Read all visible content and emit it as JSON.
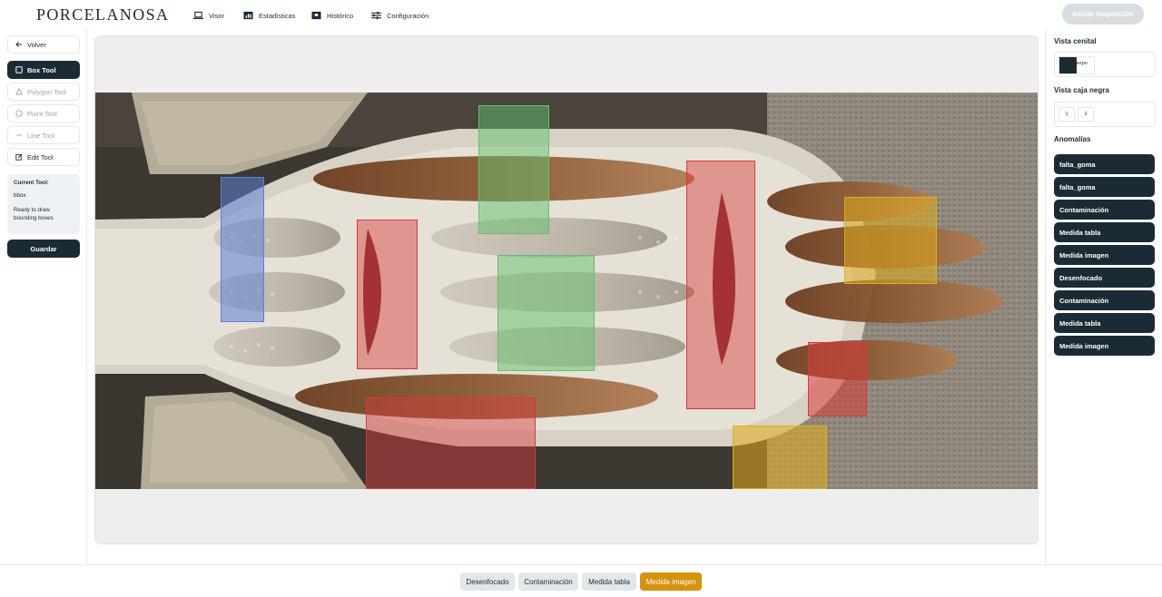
{
  "header": {
    "logo": "PORCELANOSA",
    "nav": [
      {
        "label": "Visor",
        "icon": "laptop-icon"
      },
      {
        "label": "Estadísticas",
        "icon": "bar-chart-icon"
      },
      {
        "label": "Histórico",
        "icon": "archive-icon"
      },
      {
        "label": "Configuración",
        "icon": "sliders-icon"
      }
    ],
    "start_label": "Iniciar inspección"
  },
  "left": {
    "back_label": "Volver",
    "tools": [
      {
        "label": "Box Tool",
        "icon": "square-icon",
        "state": "active"
      },
      {
        "label": "Polygon Tool",
        "icon": "triangle-icon",
        "state": "disabled"
      },
      {
        "label": "Point Tool",
        "icon": "circle-icon",
        "state": "disabled"
      },
      {
        "label": "Line Tool",
        "icon": "minus-icon",
        "state": "disabled"
      },
      {
        "label": "Edit Tool",
        "icon": "edit-icon",
        "state": "normal"
      }
    ],
    "current_tool_title": "Current Tool:",
    "current_tool_value": "bbox",
    "current_tool_status": "Ready to draw bounding boxes",
    "save_label": "Guardar"
  },
  "right": {
    "cenital_title": "Vista cenital",
    "cenital_item": "cuerpo",
    "caja_title": "Vista caja negra",
    "caja_items": [
      "1",
      "2"
    ],
    "anomalias_title": "Anomalías",
    "anomalias": [
      "falta_goma",
      "falta_goma",
      "Contaminación",
      "Medida tabla",
      "Medida imagen",
      "Desenfocado",
      "Contaminación",
      "Medida tabla",
      "Medida imagen"
    ]
  },
  "bottom": {
    "chips": [
      {
        "label": "Desenfocado",
        "selected": false
      },
      {
        "label": "Contaminación",
        "selected": false
      },
      {
        "label": "Medida tabla",
        "selected": false
      },
      {
        "label": "Medida imagen",
        "selected": true
      }
    ]
  },
  "colors": {
    "primary": "#1b2b36",
    "selected_chip": "#d4930d",
    "box_blue": "#5b7fd6",
    "box_red": "#d83a3a",
    "box_green": "#64c06e",
    "box_yellow": "#e0ad1e"
  }
}
